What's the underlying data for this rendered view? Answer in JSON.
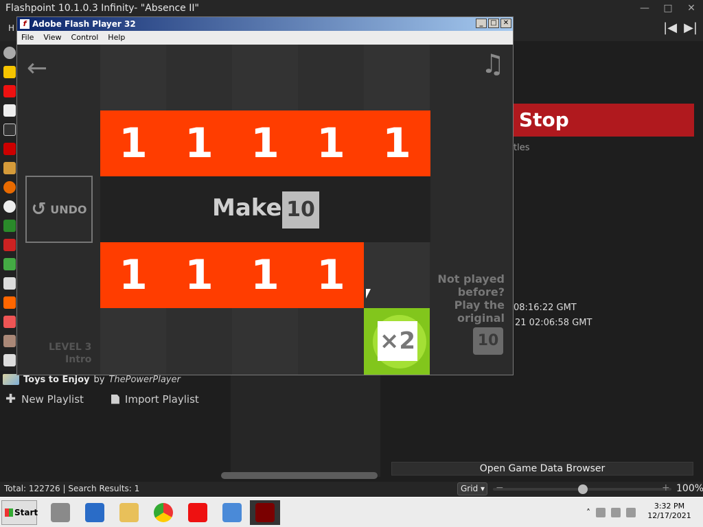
{
  "flashpoint": {
    "title": "Flashpoint 10.1.0.3 Infinity- \"Absence II\"",
    "menu_first": "H",
    "window_controls": [
      "—",
      "□",
      "✕"
    ],
    "media_controls": [
      "|◀",
      "▶|"
    ],
    "playlist": {
      "name": "Toys to Enjoy",
      "by": "by",
      "author": "ThePowerPlayer"
    },
    "new_playlist": "New Playlist",
    "import_playlist": "Import Playlist",
    "stop_label": "Stop",
    "tles_text": "tles",
    "date_1": "08:16:22 GMT",
    "date_2": "21 02:06:58 GMT",
    "open_game_data": "Open Game Data Browser",
    "status": {
      "total": "Total: 122726",
      "sep": "|",
      "search": "Search Results: 1"
    },
    "view_mode": "Grid",
    "zoom": "100%",
    "zoom_level": 0.5
  },
  "flash_player": {
    "title": "Adobe Flash Player 32",
    "menu": [
      "File",
      "View",
      "Control",
      "Help"
    ],
    "controls": [
      "_",
      "□",
      "✕"
    ]
  },
  "game": {
    "top_row": [
      "1",
      "1",
      "1",
      "1",
      "1"
    ],
    "bottom_row": [
      "1",
      "1",
      "1",
      "1"
    ],
    "make_label": "Make",
    "target": "10",
    "undo_label": "UNDO",
    "multiplier": "×2",
    "not_played": "Not played\nbefore?\nPlay the\noriginal",
    "orig_badge": "10",
    "level": "LEVEL 3",
    "level_name": "Intro",
    "accent": "#ff3d00",
    "green": "#82c61c"
  },
  "taskbar": {
    "start": "Start",
    "time": "3:32 PM",
    "date": "12/17/2021"
  }
}
